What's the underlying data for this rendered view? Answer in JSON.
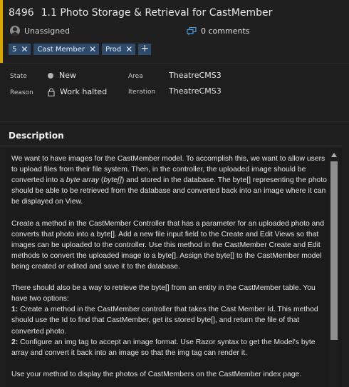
{
  "work_item": {
    "id": "8496",
    "title": "1.1 Photo Storage & Retrieval for CastMember",
    "assignee": "Unassigned",
    "comments_label": "0 comments",
    "accent_color": "#d8a600"
  },
  "tags": [
    "5",
    "Cast Member",
    "Prod"
  ],
  "tag_add_label": "+",
  "tag_remove_glyph": "✕",
  "fields": {
    "state_label": "State",
    "state_value": "New",
    "reason_label": "Reason",
    "reason_value": "Work halted",
    "area_label": "Area",
    "area_value": "TheatreCMS3",
    "iteration_label": "Iteration",
    "iteration_value": "TheatreCMS3"
  },
  "description": {
    "heading": "Description",
    "p1_a": "We want to have images for the CastMember model.  To accomplish this, we want to allow users to upload files from their file system.  Then, in the controller, the uploaded image should be converted into a ",
    "p1_em1": "byte array",
    "p1_b": " (",
    "p1_em2": "byte[]",
    "p1_c": ") and stored in the database.  The byte[] representing the photo should be able to be retrieved from the database and converted back into an image where it can be displayed on View.",
    "p2": "Create a method in the CastMember Controller that has a parameter for an uploaded photo and converts that photo into a byte[].  Add a new file input field to the Create and Edit Views so that images can be uploaded to the controller.  Use this method in the CastMember Create and Edit methods to convert the uploaded image to a byte[].  Assign the byte[] to the CastMember model being created or edited and save it to the database.",
    "p3_intro": "There should also be a way to retrieve the byte[] from an entity in the CastMember table.  You have two options:",
    "opt1_num": "1:",
    "opt1_text": " Create a method in the CastMember controller that takes the Cast Member Id.  This method should use the Id to find that CastMember, get its stored byte[], and return the file of that converted photo.",
    "opt2_num": "2:",
    "opt2_text": " Configure an img tag to accept an image format.  Use Razor syntax to get the Model's byte array and convert it back into an image so that the img tag can render it.",
    "p4": "Use your method to display the photos of CastMembers on the CastMember index page."
  }
}
